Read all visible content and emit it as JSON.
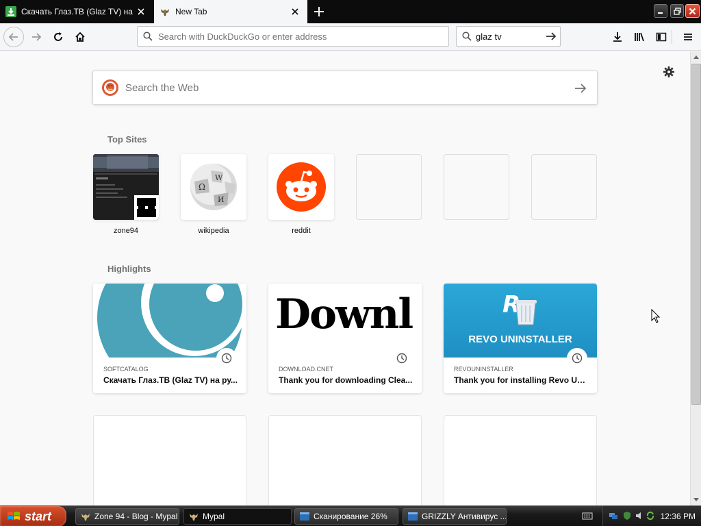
{
  "tabs": [
    {
      "title": "Скачать Глаз.ТВ (Glaz TV) на ру",
      "active": false,
      "favicon": "download-green-icon"
    },
    {
      "title": "New Tab",
      "active": true,
      "favicon": "moose-icon"
    }
  ],
  "navbar": {
    "urlbar_placeholder": "Search with DuckDuckGo or enter address",
    "searchbar_value": "glaz tv"
  },
  "content": {
    "web_search_placeholder": "Search the Web",
    "top_sites_title": "Top Sites",
    "top_sites": [
      {
        "label": "zone94"
      },
      {
        "label": "wikipedia"
      },
      {
        "label": "reddit"
      }
    ],
    "highlights_title": "Highlights",
    "highlights": [
      {
        "source": "SOFTCATALOG",
        "title": "Скачать Глаз.ТВ (Glaz TV) на ру..."
      },
      {
        "source": "DOWNLOAD.CNET",
        "title": "Thank you for downloading Clea...",
        "image_text": "Downl"
      },
      {
        "source": "REVOUNINSTALLER",
        "title": "Thank you for installing Revo Un...",
        "image_text": "REVO UNINSTALLER"
      }
    ]
  },
  "taskbar": {
    "start_label": "start",
    "tasks": [
      {
        "label": "Zone 94 - Blog - Mypal"
      },
      {
        "label": "Mypal"
      },
      {
        "label": "Сканирование 26%"
      },
      {
        "label": "GRIZZLY Антивирус ..."
      }
    ],
    "clock": "12:36 PM"
  },
  "colors": {
    "reddit": "#ff4500",
    "revo_bg": "#2a9fd0",
    "softcatalog": "#4aa3b8",
    "start": "#c0401c"
  }
}
